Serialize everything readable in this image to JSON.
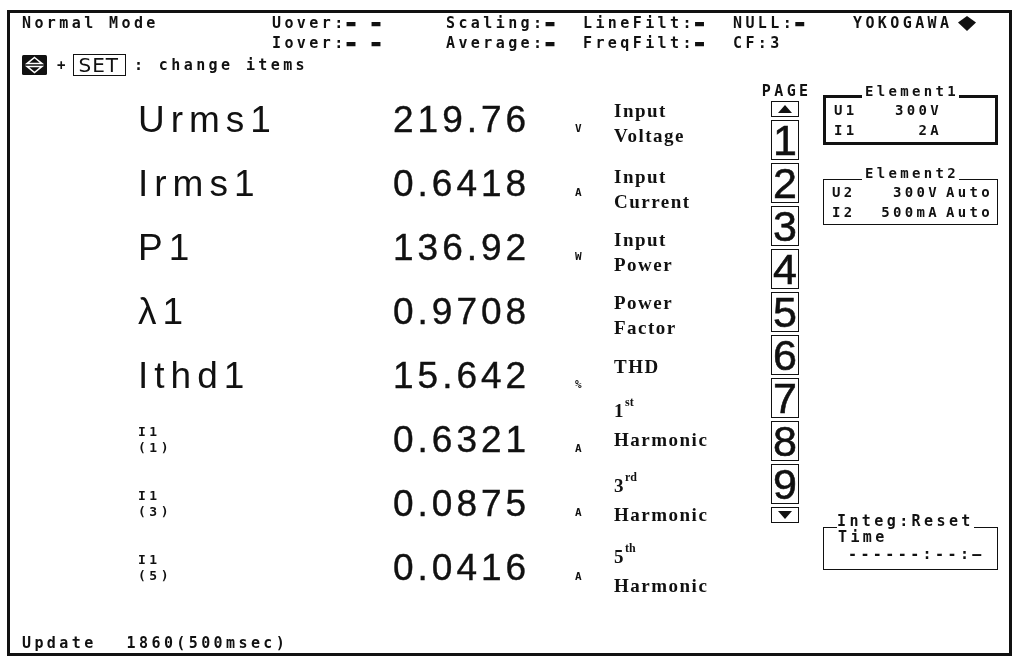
{
  "header": {
    "mode": "Normal Mode",
    "status_rows": [
      [
        {
          "label": "Uover:",
          "value": "▬ ▬"
        },
        {
          "label": "Scaling:",
          "value": "▬"
        },
        {
          "label": "LineFilt:",
          "value": "▬"
        },
        {
          "label": "NULL:",
          "value": "▬"
        }
      ],
      [
        {
          "label": "Iover:",
          "value": "▬ ▬"
        },
        {
          "label": "Average:",
          "value": "▬"
        },
        {
          "label": "FreqFilt:",
          "value": "▬"
        },
        {
          "label": "CF:",
          "value": "3"
        }
      ]
    ],
    "brand": "YOKOGAWA",
    "hint": {
      "plus": "+",
      "key": "SET",
      "text": ": change items"
    }
  },
  "measurements": [
    {
      "kind": "main",
      "label": "Urms1",
      "value": "219.76",
      "unit": "V",
      "description": "Input Voltage"
    },
    {
      "kind": "main",
      "label": "Irms1",
      "value": "0.6418",
      "unit": "A",
      "description": "Input Current"
    },
    {
      "kind": "main",
      "label": "P1",
      "value": "136.92",
      "unit": "W",
      "description": "Input Power"
    },
    {
      "kind": "main",
      "label": "λ1",
      "value": "0.9708",
      "description": "Power Factor"
    },
    {
      "kind": "main",
      "label": "Ithd1",
      "value": "15.642",
      "unit": "%",
      "description": "THD"
    },
    {
      "kind": "harmonic",
      "label": "I1",
      "order": "(1)",
      "value": "0.6321",
      "unit": "A",
      "description": "1$^{st}$ Harmonic"
    },
    {
      "kind": "harmonic",
      "label": "I1",
      "order": "(3)",
      "value": "0.0875",
      "unit": "A",
      "description": "3$^{rd}$ Harmonic"
    },
    {
      "kind": "harmonic",
      "label": "I1",
      "order": "(5)",
      "value": "0.0416",
      "unit": "A",
      "description": "5$^{th}$ Harmonic"
    }
  ],
  "pages": {
    "title": "PAGE",
    "items": [
      {
        "label": "1",
        "selected": false
      },
      {
        "label": "2",
        "selected": false
      },
      {
        "label": "3",
        "selected": false
      },
      {
        "label": "4",
        "selected": false
      },
      {
        "label": "5",
        "selected": false
      },
      {
        "label": "6",
        "selected": false
      },
      {
        "label": "7",
        "selected": false
      },
      {
        "label": "8",
        "selected": false
      },
      {
        "label": "9",
        "selected": false
      }
    ]
  },
  "elements": [
    {
      "title": "Element1",
      "selected": true,
      "ranges": [
        {
          "name": "U1",
          "range": "300V"
        },
        {
          "name": "I1",
          "range": "2A"
        }
      ]
    },
    {
      "title": "Element2",
      "selected": false,
      "ranges": [
        {
          "name": "U2",
          "range": "300V",
          "mode": "Auto"
        },
        {
          "name": "I2",
          "range": "500mA",
          "mode": "Auto"
        }
      ]
    }
  ],
  "integration": {
    "title": "Integ:Reset",
    "label": "Time",
    "value": "------:--:—"
  },
  "footer": {
    "label": "Update",
    "value": "1860(500msec)"
  }
}
